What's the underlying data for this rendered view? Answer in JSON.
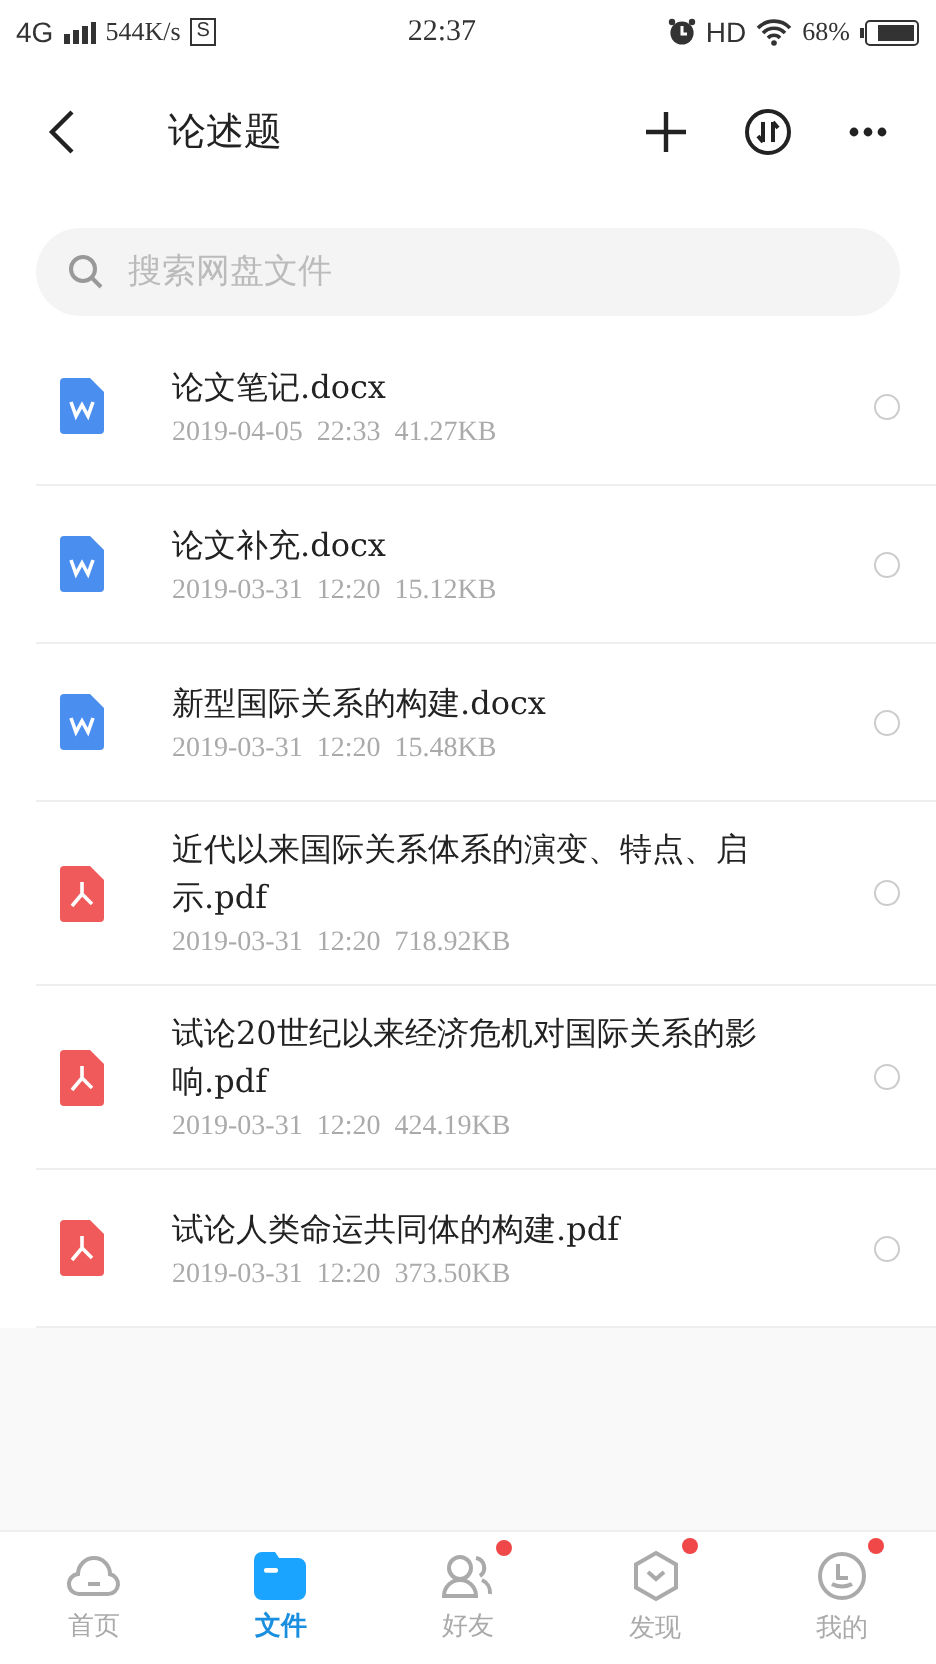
{
  "status_bar": {
    "network": "4G",
    "speed": "544K/s",
    "notice": "S",
    "time": "22:37",
    "hd": "HD",
    "battery": "68%"
  },
  "header": {
    "title": "论述题"
  },
  "search": {
    "placeholder": "搜索网盘文件"
  },
  "files": [
    {
      "kind": "word",
      "name": "论文笔记.docx",
      "date": "2019-04-05",
      "time": "22:33",
      "size": "41.27KB",
      "selected": false
    },
    {
      "kind": "word",
      "name": "论文补充.docx",
      "date": "2019-03-31",
      "time": "12:20",
      "size": "15.12KB",
      "selected": false
    },
    {
      "kind": "word",
      "name": "新型国际关系的构建.docx",
      "date": "2019-03-31",
      "time": "12:20",
      "size": "15.48KB",
      "selected": false
    },
    {
      "kind": "pdf",
      "name": "近代以来国际关系体系的演变、特点、启示.pdf",
      "date": "2019-03-31",
      "time": "12:20",
      "size": "718.92KB",
      "selected": false
    },
    {
      "kind": "pdf",
      "name": "试论20世纪以来经济危机对国际关系的影响.pdf",
      "date": "2019-03-31",
      "time": "12:20",
      "size": "424.19KB",
      "selected": false
    },
    {
      "kind": "pdf",
      "name": "试论人类命运共同体的构建.pdf",
      "date": "2019-03-31",
      "time": "12:20",
      "size": "373.50KB",
      "selected": false
    }
  ],
  "tabs": [
    {
      "kind": "home",
      "label": "首页",
      "selected": false,
      "badge": false
    },
    {
      "kind": "files",
      "label": "文件",
      "selected": true,
      "badge": false
    },
    {
      "kind": "friends",
      "label": "好友",
      "selected": false,
      "badge": true
    },
    {
      "kind": "discover",
      "label": "发现",
      "selected": false,
      "badge": true
    },
    {
      "kind": "me",
      "label": "我的",
      "selected": false,
      "badge": true
    }
  ]
}
